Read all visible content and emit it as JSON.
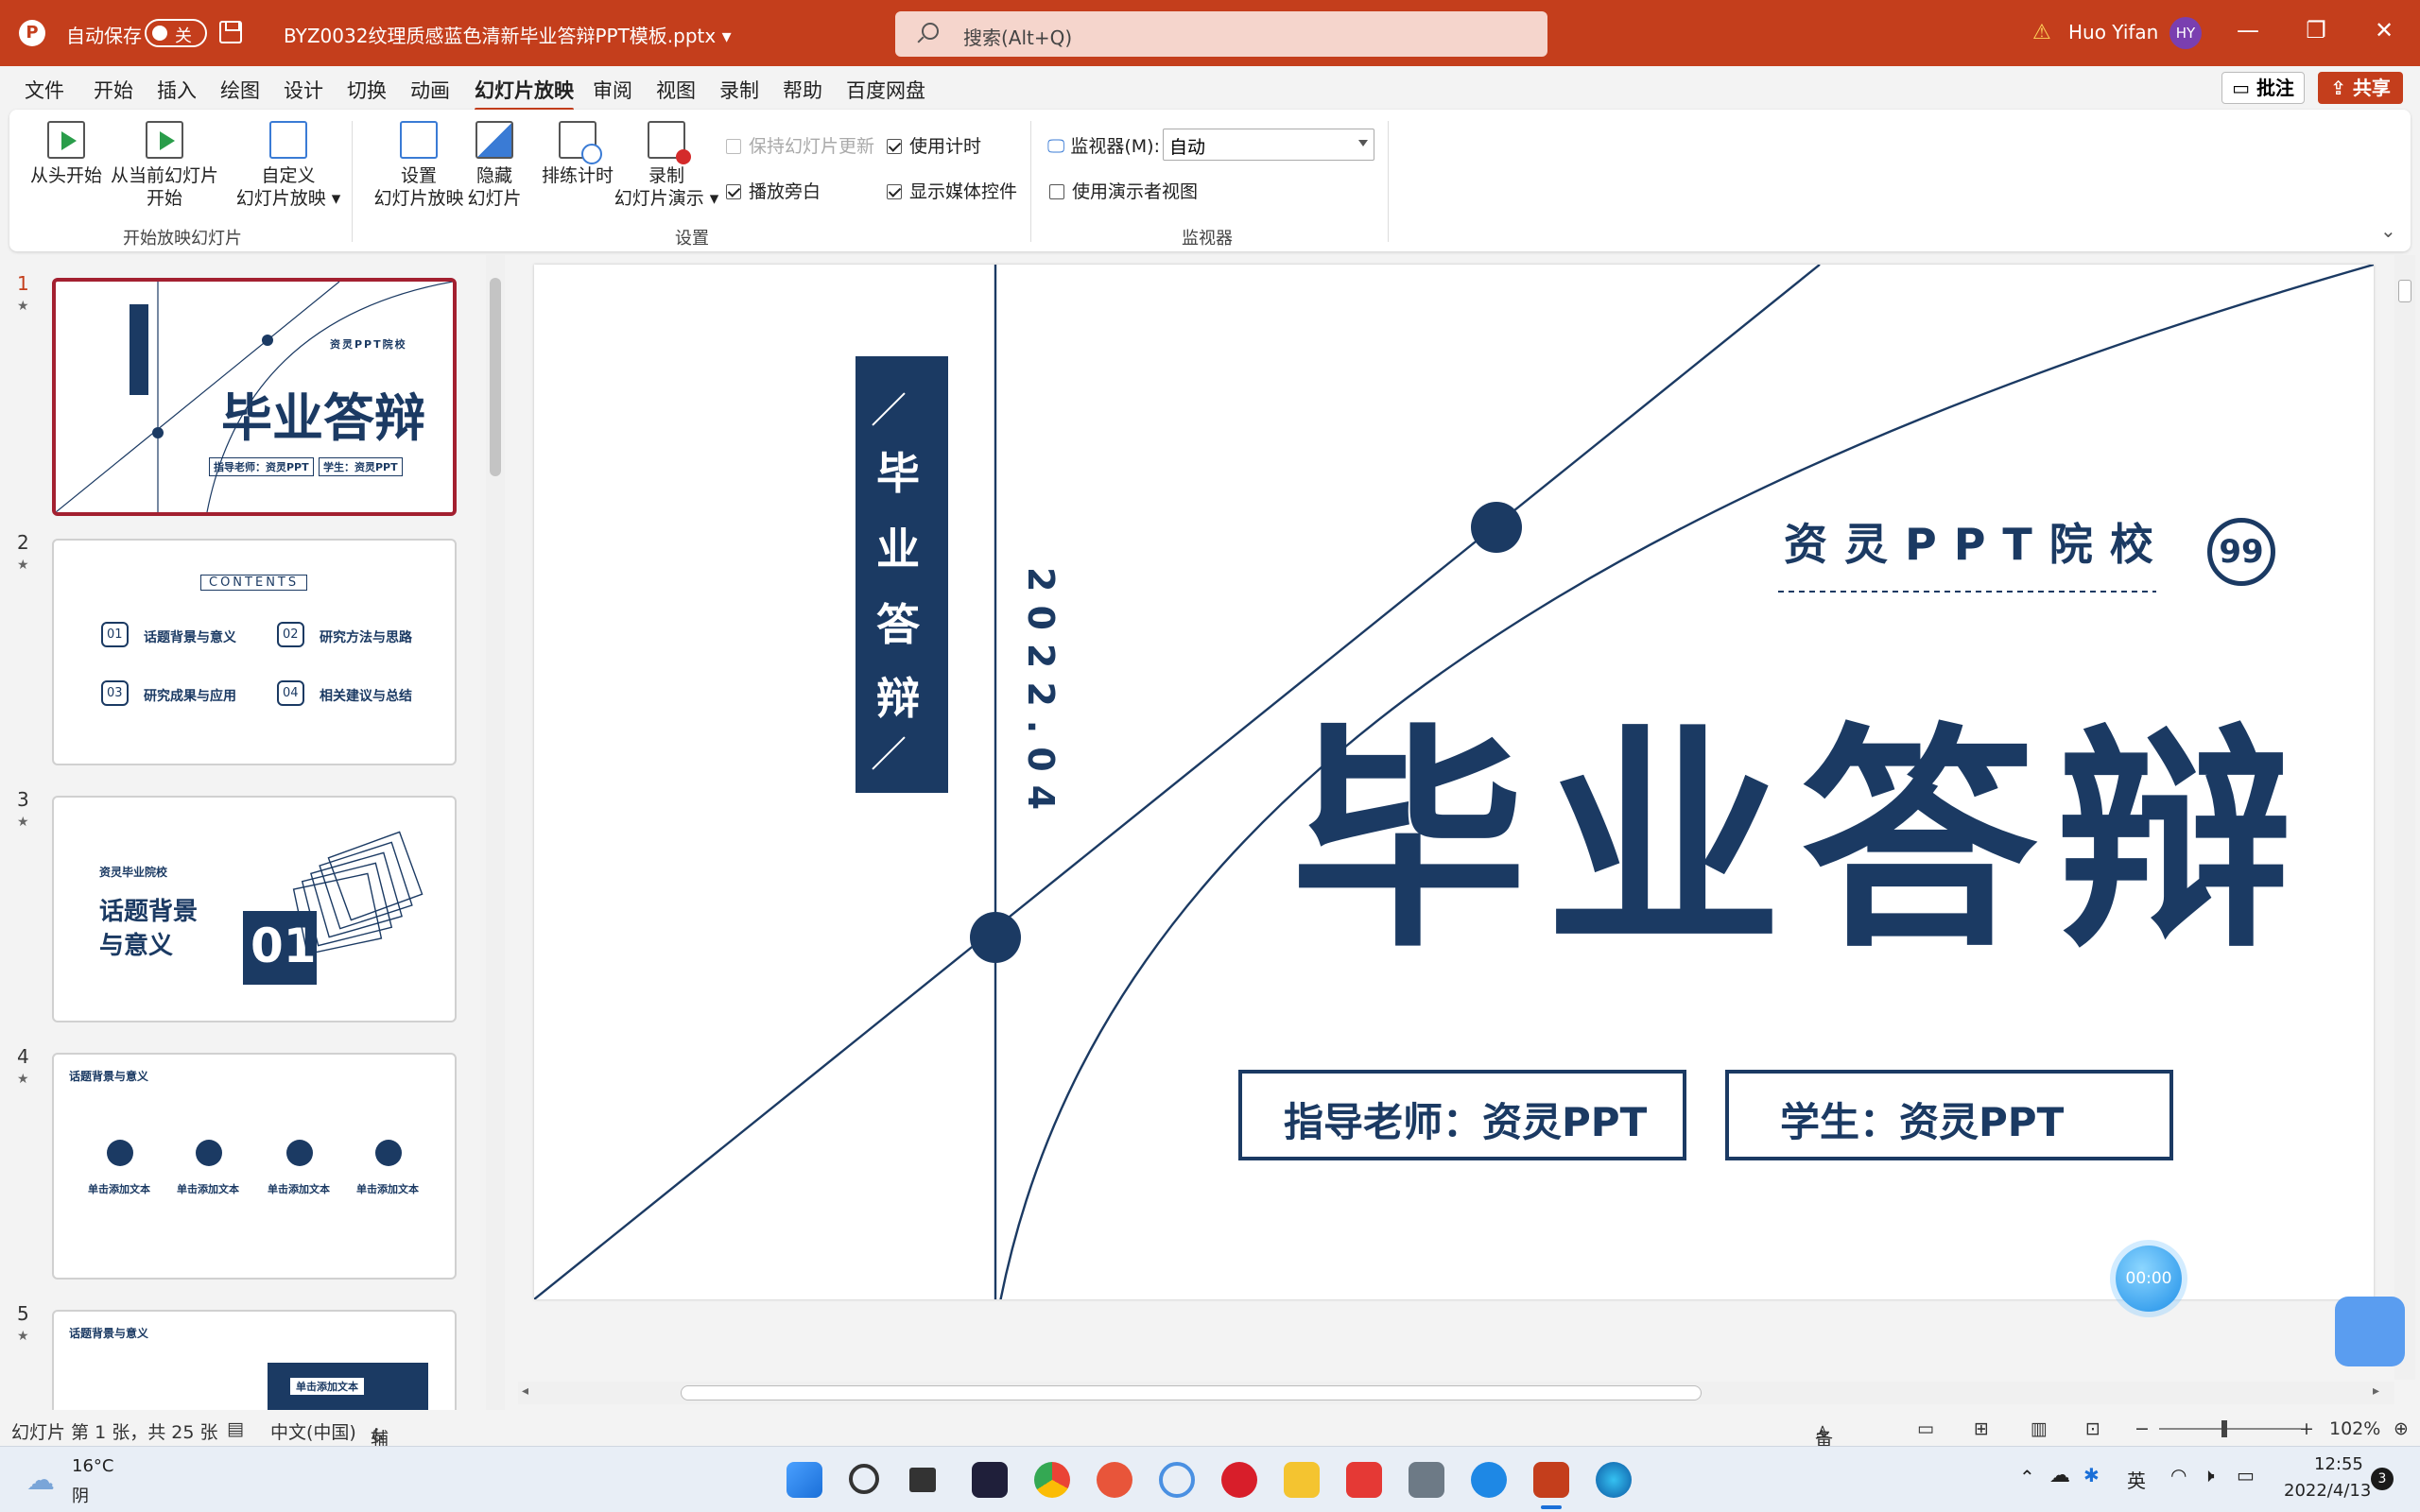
{
  "titlebar": {
    "app_icon": "P",
    "autosave_label": "自动保存",
    "autosave_state": "关",
    "doc_title": "BYZ0032纹理质感蓝色清新毕业答辩PPT模板.pptx",
    "search_placeholder": "搜索(Alt+Q)",
    "user_name": "Huo Yifan",
    "user_initials": "HY",
    "minimize": "—",
    "restore": "❐",
    "close": "✕"
  },
  "menu": {
    "tabs": [
      "文件",
      "开始",
      "插入",
      "绘图",
      "设计",
      "切换",
      "动画",
      "幻灯片放映",
      "审阅",
      "视图",
      "录制",
      "帮助",
      "百度网盘"
    ],
    "active_tab": "幻灯片放映",
    "comment": "批注",
    "share": "共享"
  },
  "ribbon": {
    "from_start": "从头开始",
    "from_current_1": "从当前幻灯片",
    "from_current_2": "开始",
    "custom_1": "自定义",
    "custom_2": "幻灯片放映",
    "group_start": "开始放映幻灯片",
    "setup_1": "设置",
    "setup_2": "幻灯片放映",
    "hide_1": "隐藏",
    "hide_2": "幻灯片",
    "rehearse": "排练计时",
    "record_1": "录制",
    "record_2": "幻灯片演示",
    "keep_updated": "保持幻灯片更新",
    "use_timings": "使用计时",
    "play_narrations": "播放旁白",
    "show_media": "显示媒体控件",
    "group_setup": "设置",
    "monitor_label": "监视器(M):",
    "monitor_value": "自动",
    "presenter_view": "使用演示者视图",
    "group_monitor": "监视器"
  },
  "thumbnails": {
    "numbers": [
      "1",
      "2",
      "3",
      "4",
      "5"
    ],
    "active": 1,
    "t1": {
      "title": "毕业答辩",
      "school": "资灵PPT院校",
      "teacher": "指导老师：资灵PPT",
      "student": "学生：资灵PPT"
    },
    "t2": {
      "contents": "CONTENTS",
      "items": [
        "话题背景与意义",
        "研究方法与思路",
        "研究成果与应用",
        "相关建议与总结"
      ],
      "nums": [
        "01",
        "02",
        "03",
        "04"
      ]
    },
    "t3": {
      "school": "资灵毕业院校",
      "title1": "话题背景",
      "title2": "与意义",
      "num": "01"
    },
    "t4": {
      "heading": "话题背景与意义",
      "cols": [
        "单击添加文本",
        "单击添加文本",
        "单击添加文本",
        "单击添加文本"
      ]
    },
    "t5": {
      "heading": "话题背景与意义",
      "box": "单击添加文本"
    }
  },
  "slide": {
    "vertical_title": [
      "毕",
      "业",
      "答",
      "辩"
    ],
    "date": "2022.04",
    "school": "资灵PPT院校",
    "quote_icon": "99",
    "main_title": "毕业答辩",
    "teacher": "指导老师：资灵PPT",
    "student": "学生：资灵PPT",
    "navy": "#1b3a63"
  },
  "timer": "00:00",
  "status": {
    "slide_info": "幻灯片 第 1 张，共 25 张",
    "language": "中文(中国)",
    "accessibility": "辅助功能: 调查",
    "notes": "备注",
    "zoom": "102%",
    "zoom_minus": "−",
    "zoom_plus": "+"
  },
  "taskbar": {
    "temp": "16°C",
    "weather": "阴",
    "ime": "英",
    "time": "12:55",
    "date": "2022/4/13",
    "notify_count": "3"
  }
}
